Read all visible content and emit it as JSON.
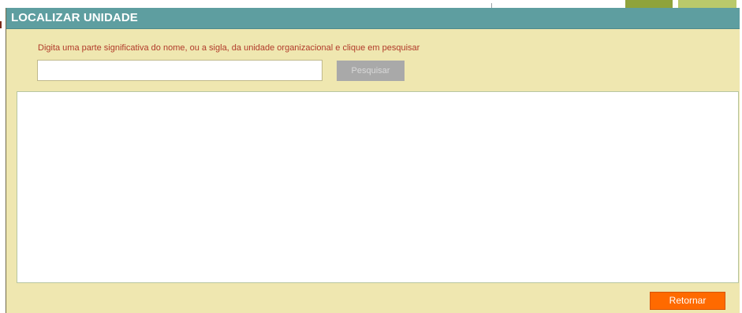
{
  "dialog": {
    "title": "LOCALIZAR UNIDADE",
    "instruction": "Digita uma parte significativa do nome, ou a sigla, da unidade organizacional e clique em pesquisar",
    "search": {
      "value": "",
      "placeholder": ""
    },
    "search_button_label": "Pesquisar",
    "return_button_label": "Retornar"
  },
  "colors": {
    "titlebar": "#5e9ea0",
    "dialog_bg": "#efe7b0",
    "instruction_text": "#b13a2a",
    "search_button_disabled": "#a9a9a9",
    "return_button": "#ff6a00"
  }
}
